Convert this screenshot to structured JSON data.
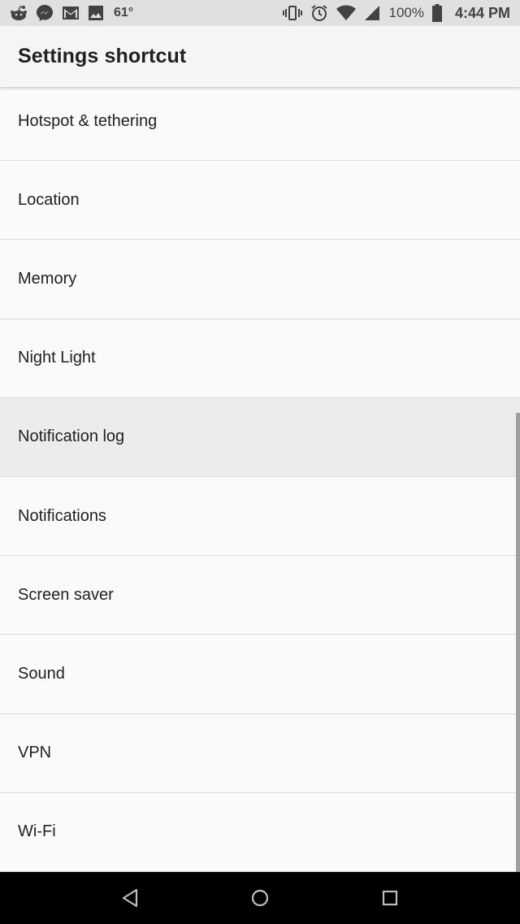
{
  "status_bar": {
    "temperature": "61°",
    "battery_percent": "100%",
    "time": "4:44 PM",
    "icons_left": [
      "reddit-icon",
      "messenger-icon",
      "gmail-icon",
      "photo-icon"
    ],
    "icons_right": [
      "vibrate-icon",
      "alarm-icon",
      "wifi-icon",
      "signal-icon",
      "battery-icon"
    ]
  },
  "app_bar": {
    "title": "Settings shortcut"
  },
  "list": {
    "items": [
      {
        "label": "Hotspot & tethering"
      },
      {
        "label": "Location"
      },
      {
        "label": "Memory"
      },
      {
        "label": "Night Light"
      },
      {
        "label": "Notification log"
      },
      {
        "label": "Notifications"
      },
      {
        "label": "Screen saver"
      },
      {
        "label": "Sound"
      },
      {
        "label": "VPN"
      },
      {
        "label": "Wi-Fi"
      }
    ],
    "pressed_index": 4
  },
  "nav_bar": {
    "buttons": [
      "back-icon",
      "home-icon",
      "recents-icon"
    ]
  },
  "colors": {
    "background": "#fafafa",
    "status_bar": "#e0e0e0",
    "app_bar": "#f5f5f5",
    "pressed_row": "#ececec",
    "text": "#212121",
    "nav_bar": "#000000"
  }
}
